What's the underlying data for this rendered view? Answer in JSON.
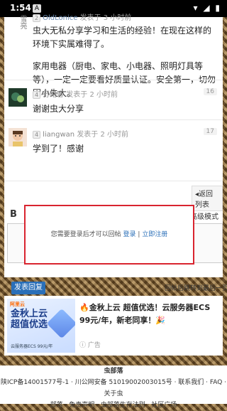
{
  "status": {
    "time": "1:54",
    "app_icon": "A",
    "indicators": "▾ ◢ ▮"
  },
  "posts": [
    {
      "avatar_text": "雪亮",
      "level": "2",
      "user": "OldLonice",
      "time": "发表于 3 小时前",
      "floor": "",
      "paragraphs": [
        "虫大无私分享学习和生活的经验！在现在这样的环境下实属难得了。",
        "家用电器（厨电、家电、小电器、照明灯具等等），一定一定要看好质量认证。安全第一，切勿因小失大。"
      ]
    },
    {
      "level": "4",
      "user": "行路客",
      "time": "发表于 2 小时前",
      "floor": "16",
      "text": "谢谢虫大分享"
    },
    {
      "level": "4",
      "user": "liangwan",
      "time": "发表于 2 小时前",
      "floor": "17",
      "text": "学到了！感谢"
    }
  ],
  "return_list": "返回列表",
  "editor": {
    "tools": [
      "B",
      "A",
      "image-icon",
      "link-icon",
      "attach-icon",
      "refresh-icon",
      "code-icon"
    ],
    "advanced": "高级模式",
    "login_msg": "您需要登录后才可以回帖",
    "login_link": "登录",
    "separator": " | ",
    "register_link": "立即注册",
    "submit": "发表回复",
    "hint": "回帖后跳转到最后一页"
  },
  "ad": {
    "brand": "阿里云",
    "image_title_1": "金秋上云",
    "image_title_2": "超值优选",
    "image_small": "云服务器ECS 99元/年",
    "text": "🔥金秋上云 超值优选！云服务器ECS 99元/年，新老同享！🎉",
    "label": "广告"
  },
  "footer": {
    "title": "虫部落",
    "line1": "陕ICP备14001577号-1 · 川公网安备 51019002003015号 · 联系我们 · FAQ · 关于虫",
    "line2": "部落 · 免责声明 · 虫部落生存法则 · 社区广场"
  }
}
